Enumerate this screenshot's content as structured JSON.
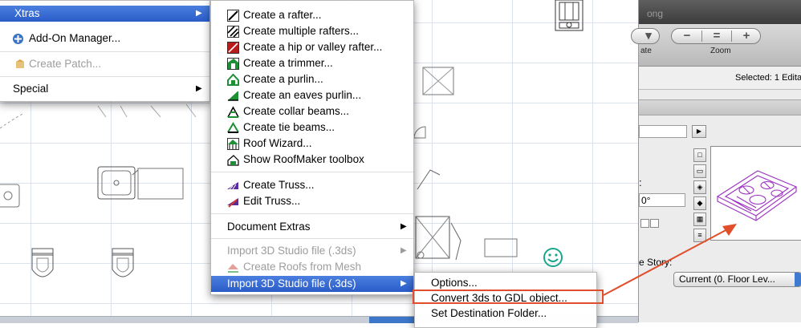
{
  "xtras_menu": {
    "items": [
      {
        "label": "Xtras",
        "has_submenu": true,
        "highlighted": true
      },
      {
        "label": "Add-On Manager..."
      },
      {
        "label": "Create Patch...",
        "disabled": true
      },
      {
        "label": "Special",
        "has_submenu": true
      }
    ]
  },
  "xtras_submenu": {
    "items": [
      {
        "label": "Create a rafter...",
        "icon": "rafter-icon"
      },
      {
        "label": "Create multiple rafters...",
        "icon": "multiple-rafters-icon"
      },
      {
        "label": "Create a hip or valley rafter...",
        "icon": "hip-valley-rafter-icon"
      },
      {
        "label": "Create a trimmer...",
        "icon": "trimmer-icon"
      },
      {
        "label": "Create a purlin...",
        "icon": "purlin-icon"
      },
      {
        "label": "Create an eaves purlin...",
        "icon": "eaves-purlin-icon"
      },
      {
        "label": "Create collar beams...",
        "icon": "collar-beams-icon"
      },
      {
        "label": "Create tie beams...",
        "icon": "tie-beams-icon"
      },
      {
        "label": "Roof Wizard...",
        "icon": "roof-wizard-icon"
      },
      {
        "label": "Show RoofMaker toolbox",
        "icon": "roofmaker-toolbox-icon"
      },
      {
        "label": "Create Truss...",
        "icon": "truss-icon"
      },
      {
        "label": "Edit Truss...",
        "icon": "edit-truss-icon"
      },
      {
        "label": "Document Extras",
        "has_submenu": true
      },
      {
        "label": "Import 3D Studio file (.3ds)",
        "has_submenu": true,
        "disabled": true
      },
      {
        "label": "Create Roofs from Mesh",
        "disabled": true,
        "icon": "roofs-from-mesh-icon"
      },
      {
        "label": "Import 3D Studio file (.3ds)",
        "has_submenu": true,
        "highlighted": true
      }
    ]
  },
  "import_submenu": {
    "items": [
      {
        "label": "Options..."
      },
      {
        "label": "Convert 3ds to GDL object...",
        "callout": true
      },
      {
        "label": "Set Destination Folder..."
      }
    ]
  },
  "panel": {
    "title": "ong",
    "toolbar_left_label": "ate",
    "zoom_label": "Zoom",
    "zoom_buttons": [
      "−",
      "=",
      "+"
    ],
    "selected_text": "Selected: 1 Edita",
    "angle_value": "0°",
    "story_label": "e Story:",
    "story_value": "Current (0. Floor Lev..."
  },
  "colors": {
    "menu_highlight": "#2f63cf",
    "callout": "#e04e2b",
    "preview_object": "#9b2fc0"
  }
}
